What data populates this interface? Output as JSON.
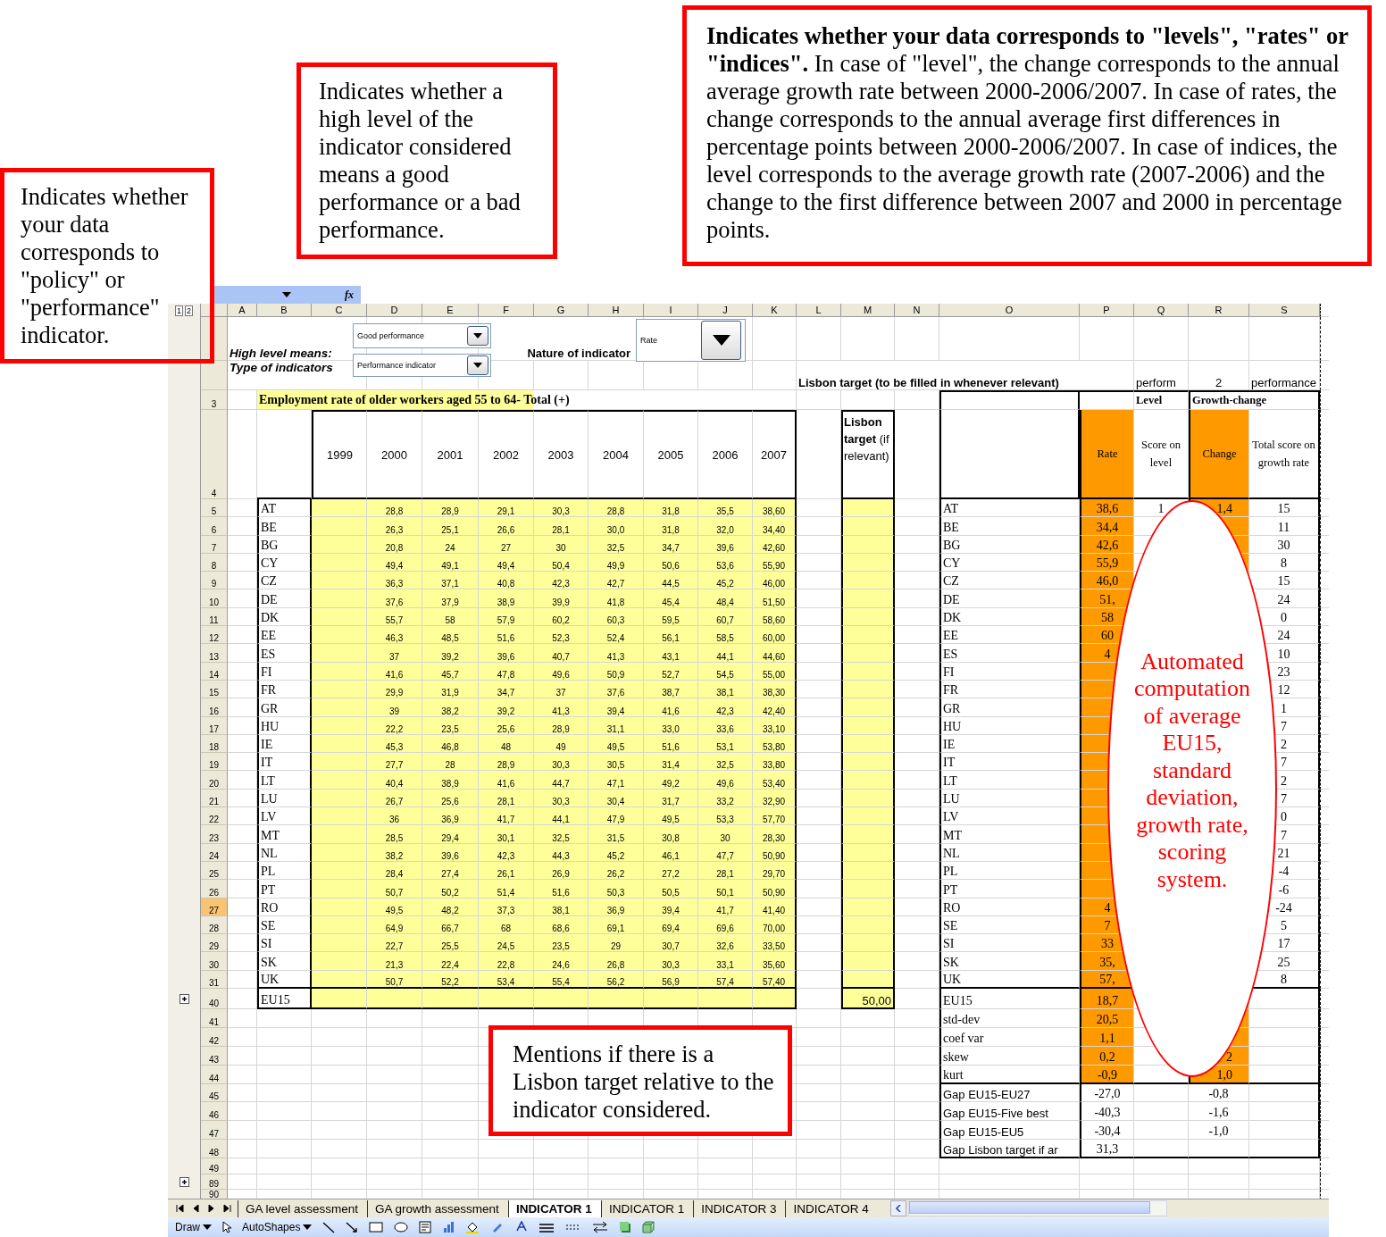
{
  "callouts": [
    {
      "text": "Indicates whether your data corresponds to \"policy\" or \"performance\" indicator."
    },
    {
      "text": "Indicates whether a high level of the indicator considered means a good performance or a bad performance."
    },
    {
      "text": "**Indicates whether your data corresponds to \"levels\", \"rates\" or \"indices\".** In case of \"level\", the change corresponds to the annual average growth rate between 2000-2006/2007. In case of rates, the change corresponds to the annual average first differences in percentage points between 2000-2006/2007. In case of indices, the level corresponds to the average growth rate (2007-2006) and the change to the first difference between 2007 and 2000 in percentage points."
    },
    {
      "text": "Mentions if there is a Lisbon target relative to the indicator considered."
    }
  ],
  "ellipse_note": {
    "text": "Automated computation of average EU15, standard deviation, growth rate, scoring system."
  },
  "formula_bar": {
    "fx_label": "fx"
  },
  "outline_levels": [
    "1",
    "2"
  ],
  "column_letters": [
    "A",
    "B",
    "C",
    "D",
    "E",
    "F",
    "G",
    "H",
    "I",
    "J",
    "K",
    "L",
    "M",
    "N",
    "O",
    "P",
    "Q",
    "R",
    "S"
  ],
  "controls": {
    "high_level_label": "High level means:",
    "high_level_value": "Good performance",
    "type_label": "Type of indicators",
    "type_value": "Performance indicator",
    "nature_label": "Nature of indicator",
    "nature_value": "Rate"
  },
  "lisbon_note": "Lisbon target (to be filled in whenever relevant)",
  "row2_right": {
    "q": "perform",
    "r": "2",
    "s": "performance"
  },
  "title_row": {
    "n": "3",
    "text": "Employment rate of older workers aged 55 to 64- Total (+)",
    "level": "Level",
    "growth": "Growth-change"
  },
  "header_row": {
    "n": "4",
    "years": [
      "1999",
      "2000",
      "2001",
      "2002",
      "2003",
      "2004",
      "2005",
      "2006",
      "2007"
    ],
    "lisbon": "**Lisbon target** (if relevant)",
    "rate": "Rate",
    "score": "Score on level",
    "change": "Change",
    "total": "Total score on growth rate"
  },
  "rows": [
    {
      "n": "5",
      "active": false,
      "code": "AT",
      "values": [
        "28,8",
        "28,9",
        "29,1",
        "30,3",
        "28,8",
        "31,8",
        "35,5",
        "38,60"
      ],
      "label": "AT",
      "rate": "38,6",
      "score": "1",
      "change": "1,4",
      "total": "15"
    },
    {
      "n": "6",
      "active": false,
      "code": "BE",
      "values": [
        "26,3",
        "25,1",
        "26,6",
        "28,1",
        "30,0",
        "31,8",
        "32,0",
        "34,40"
      ],
      "label": "BE",
      "rate": "34,4",
      "total": "11"
    },
    {
      "n": "7",
      "active": false,
      "code": "BG",
      "values": [
        "20,8",
        "24",
        "27",
        "30",
        "32,5",
        "34,7",
        "39,6",
        "42,60"
      ],
      "label": "BG",
      "rate": "42,6",
      "total": "30"
    },
    {
      "n": "8",
      "active": false,
      "code": "CY",
      "values": [
        "49,4",
        "49,1",
        "49,4",
        "50,4",
        "49,9",
        "50,6",
        "53,6",
        "55,90"
      ],
      "label": "CY",
      "rate": "55,9",
      "total": "8"
    },
    {
      "n": "9",
      "active": false,
      "code": "CZ",
      "values": [
        "36,3",
        "37,1",
        "40,8",
        "42,3",
        "42,7",
        "44,5",
        "45,2",
        "46,00"
      ],
      "label": "CZ",
      "rate": "46,0",
      "total": "15"
    },
    {
      "n": "10",
      "active": false,
      "code": "DE",
      "values": [
        "37,6",
        "37,9",
        "38,9",
        "39,9",
        "41,8",
        "45,4",
        "48,4",
        "51,50"
      ],
      "label": "DE",
      "rate": "51,",
      "total": "24"
    },
    {
      "n": "11",
      "active": false,
      "code": "DK",
      "values": [
        "55,7",
        "58",
        "57,9",
        "60,2",
        "60,3",
        "59,5",
        "60,7",
        "58,60"
      ],
      "label": "DK",
      "rate": "58",
      "total": "0"
    },
    {
      "n": "12",
      "active": false,
      "code": "EE",
      "values": [
        "46,3",
        "48,5",
        "51,6",
        "52,3",
        "52,4",
        "56,1",
        "58,5",
        "60,00"
      ],
      "label": "EE",
      "rate": "60",
      "total": "24"
    },
    {
      "n": "13",
      "active": false,
      "code": "ES",
      "values": [
        "37",
        "39,2",
        "39,6",
        "40,7",
        "41,3",
        "43,1",
        "44,1",
        "44,60"
      ],
      "label": "ES",
      "rate": "4",
      "total": "10"
    },
    {
      "n": "14",
      "active": false,
      "code": "FI",
      "values": [
        "41,6",
        "45,7",
        "47,8",
        "49,6",
        "50,9",
        "52,7",
        "54,5",
        "55,00"
      ],
      "label": "FI",
      "total": "23"
    },
    {
      "n": "15",
      "active": false,
      "code": "FR",
      "values": [
        "29,9",
        "31,9",
        "34,7",
        "37",
        "37,6",
        "38,7",
        "38,1",
        "38,30"
      ],
      "label": "FR",
      "total": "12"
    },
    {
      "n": "16",
      "active": false,
      "code": "GR",
      "values": [
        "39",
        "38,2",
        "39,2",
        "41,3",
        "39,4",
        "41,6",
        "42,3",
        "42,40"
      ],
      "label": "GR",
      "total": "1"
    },
    {
      "n": "17",
      "active": false,
      "code": "HU",
      "values": [
        "22,2",
        "23,5",
        "25,6",
        "28,9",
        "31,1",
        "33,0",
        "33,6",
        "33,10"
      ],
      "label": "HU",
      "total": "7"
    },
    {
      "n": "18",
      "active": false,
      "code": "IE",
      "values": [
        "45,3",
        "46,8",
        "48",
        "49",
        "49,5",
        "51,6",
        "53,1",
        "53,80"
      ],
      "label": "IE",
      "total": "2"
    },
    {
      "n": "19",
      "active": false,
      "code": "IT",
      "values": [
        "27,7",
        "28",
        "28,9",
        "30,3",
        "30,5",
        "31,4",
        "32,5",
        "33,80"
      ],
      "label": "IT",
      "total": "7"
    },
    {
      "n": "20",
      "active": false,
      "code": "LT",
      "values": [
        "40,4",
        "38,9",
        "41,6",
        "44,7",
        "47,1",
        "49,2",
        "49,6",
        "53,40"
      ],
      "label": "LT",
      "total": "2"
    },
    {
      "n": "21",
      "active": false,
      "code": "LU",
      "values": [
        "26,7",
        "25,6",
        "28,1",
        "30,3",
        "30,4",
        "31,7",
        "33,2",
        "32,90"
      ],
      "label": "LU",
      "total": "7"
    },
    {
      "n": "22",
      "active": false,
      "code": "LV",
      "values": [
        "36",
        "36,9",
        "41,7",
        "44,1",
        "47,9",
        "49,5",
        "53,3",
        "57,70"
      ],
      "label": "LV",
      "total": "0"
    },
    {
      "n": "23",
      "active": false,
      "code": "MT",
      "values": [
        "28,5",
        "29,4",
        "30,1",
        "32,5",
        "31,5",
        "30,8",
        "30",
        "28,30"
      ],
      "label": "MT",
      "total": "7"
    },
    {
      "n": "24",
      "active": false,
      "code": "NL",
      "values": [
        "38,2",
        "39,6",
        "42,3",
        "44,3",
        "45,2",
        "46,1",
        "47,7",
        "50,90"
      ],
      "label": "NL",
      "total": "21"
    },
    {
      "n": "25",
      "active": false,
      "code": "PL",
      "values": [
        "28,4",
        "27,4",
        "26,1",
        "26,9",
        "26,2",
        "27,2",
        "28,1",
        "29,70"
      ],
      "label": "PL",
      "total": "-4"
    },
    {
      "n": "26",
      "active": false,
      "code": "PT",
      "values": [
        "50,7",
        "50,2",
        "51,4",
        "51,6",
        "50,3",
        "50,5",
        "50,1",
        "50,90"
      ],
      "label": "PT",
      "total": "-6"
    },
    {
      "n": "27",
      "active": true,
      "code": "RO",
      "values": [
        "49,5",
        "48,2",
        "37,3",
        "38,1",
        "36,9",
        "39,4",
        "41,7",
        "41,40"
      ],
      "label": "RO",
      "rate": "4",
      "total": "-24"
    },
    {
      "n": "28",
      "active": false,
      "code": "SE",
      "values": [
        "64,9",
        "66,7",
        "68",
        "68,6",
        "69,1",
        "69,4",
        "69,6",
        "70,00"
      ],
      "label": "SE",
      "rate": "7",
      "total": "5"
    },
    {
      "n": "29",
      "active": false,
      "code": "SI",
      "values": [
        "22,7",
        "25,5",
        "24,5",
        "23,5",
        "29",
        "30,7",
        "32,6",
        "33,50"
      ],
      "label": "SI",
      "rate": "33",
      "total": "17"
    },
    {
      "n": "30",
      "active": false,
      "code": "SK",
      "values": [
        "21,3",
        "22,4",
        "22,8",
        "24,6",
        "26,8",
        "30,3",
        "33,1",
        "35,60"
      ],
      "label": "SK",
      "rate": "35,",
      "total": "25"
    },
    {
      "n": "31",
      "active": false,
      "code": "UK",
      "values": [
        "50,7",
        "52,2",
        "53,4",
        "55,4",
        "56,2",
        "56,9",
        "57,4",
        "57,40"
      ],
      "label": "UK",
      "rate": "57,",
      "total": "8"
    }
  ],
  "eu15_row": {
    "n": "40",
    "outline_plus": true,
    "code": "EU15",
    "lisbon": "50,00",
    "label": "EU15",
    "rate": "18,7"
  },
  "stats_rows": [
    {
      "n": "41",
      "kind": "moment",
      "label": "std-dev",
      "rate": "20,5"
    },
    {
      "n": "42",
      "kind": "moment",
      "label": "coef var",
      "rate": "1,1"
    },
    {
      "n": "43",
      "kind": "moment",
      "label": "skew",
      "rate": "0,2",
      "change": "2"
    },
    {
      "n": "44",
      "kind": "moment",
      "label": "kurt",
      "rate": "-0,9",
      "change": "1,0"
    },
    {
      "n": "45",
      "kind": "gap",
      "label": "Gap EU15-EU27",
      "rate": "-27,0",
      "change": "-0,8"
    },
    {
      "n": "46",
      "kind": "gap",
      "label": "Gap EU15-Five best",
      "rate": "-40,3",
      "change": "-1,6"
    },
    {
      "n": "47",
      "kind": "gap",
      "label": "Gap EU15-EU5",
      "rate": "-30,4",
      "change": "-1,0"
    },
    {
      "n": "48",
      "kind": "gap",
      "label": "Gap Lisbon target if ar",
      "rate": "31,3"
    }
  ],
  "blank_rows": [
    {
      "n": "49",
      "outline_plus": false
    },
    {
      "n": "89",
      "outline_plus": true
    },
    {
      "n": "90",
      "outline_plus": false
    }
  ],
  "sheet_tabs": [
    {
      "label": "GA level assessment",
      "selected": false
    },
    {
      "label": "GA growth assessment",
      "selected": false
    },
    {
      "label": "INDICATOR 1",
      "selected": true
    },
    {
      "label": "INDICATOR 1",
      "selected": false
    },
    {
      "label": "INDICATOR 3",
      "selected": false
    },
    {
      "label": "INDICATOR 4",
      "selected": false
    }
  ],
  "draw_toolbar": {
    "draw": "Draw",
    "autoshapes": "AutoShapes"
  }
}
